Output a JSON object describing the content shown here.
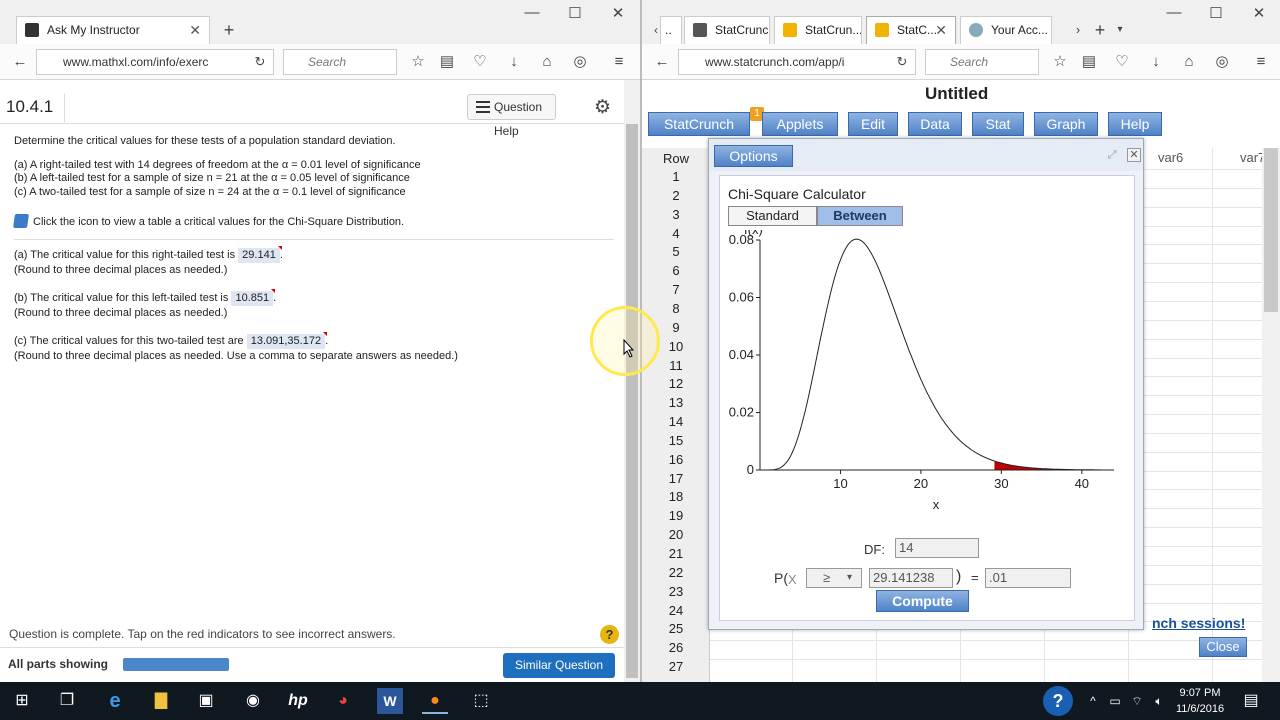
{
  "left_browser": {
    "tab_title": "Ask My Instructor",
    "url": "www.mathxl.com/info/exerc",
    "search_placeholder": "Search"
  },
  "question": {
    "number": "10.4.1",
    "help_label": "Question Help",
    "intro": "Determine the critical values for these tests of a population standard deviation.",
    "parts": [
      "(a) A right-tailed test with 14 degrees of freedom at the α = 0.01 level of significance",
      "(b) A left-tailed test for a sample of size n = 21 at the α = 0.05 level of significance",
      "(c) A two-tailed test for a sample of size n = 24 at the α = 0.1 level of significance"
    ],
    "icon_text": "Click the icon to view a table a critical values for the Chi-Square Distribution.",
    "answers": [
      {
        "prefix": "(a) The critical value for this right-tailed test is",
        "value": "29.141",
        "note": "(Round to three decimal places as needed.)"
      },
      {
        "prefix": "(b) The critical value for this left-tailed test is",
        "value": "10.851",
        "note": "(Round to three decimal places as needed.)"
      },
      {
        "prefix": "(c) The critical values for this two-tailed test are",
        "value": "13.091,35.172",
        "note": "(Round to three decimal places as needed. Use a comma to separate answers as needed.)"
      }
    ],
    "complete_msg": "Question is complete. Tap on the red indicators to see incorrect answers.",
    "all_parts": "All parts showing",
    "similar_label": "Similar Question"
  },
  "right_browser": {
    "tabs": [
      "StatCrunch",
      "StatCrun...",
      "StatC...",
      "Your Acc..."
    ],
    "url": "www.statcrunch.com/app/i",
    "search_placeholder": "Search"
  },
  "statcrunch": {
    "title": "Untitled",
    "menu": [
      "StatCrunch",
      "Applets",
      "Edit",
      "Data",
      "Stat",
      "Graph",
      "Help"
    ],
    "badge": "1",
    "row_label": "Row",
    "rows": [
      "1",
      "2",
      "3",
      "4",
      "5",
      "6",
      "7",
      "8",
      "9",
      "10",
      "11",
      "12",
      "13",
      "14",
      "15",
      "16",
      "17",
      "18",
      "19",
      "20",
      "21",
      "22",
      "23",
      "24",
      "25",
      "26",
      "27"
    ],
    "col_labels": [
      "var6",
      "var7"
    ],
    "sessions_text": "nch sessions!",
    "close_label": "Close"
  },
  "calculator": {
    "options_label": "Options",
    "title": "Chi-Square Calculator",
    "mode_standard": "Standard",
    "mode_between": "Between",
    "df_label": "DF:",
    "df_value": "14",
    "p_label": "P(",
    "x_label": "X",
    "comparator": "≥",
    "x_value": "29.141238",
    "equals": "=",
    "p_value": ".01",
    "compute_label": "Compute"
  },
  "chart_data": {
    "type": "area",
    "ylabel": "f(x)",
    "xlabel": "x",
    "xticks": [
      10,
      20,
      30,
      40
    ],
    "yticks": [
      "0",
      "0.02",
      "0.04",
      "0.06",
      "0.08"
    ],
    "xlim": [
      0,
      44
    ],
    "ylim": [
      0,
      0.08
    ],
    "distribution": "chi-square",
    "df": 14,
    "shaded_from": 29.141238,
    "shade_color": "#c00000"
  },
  "taskbar": {
    "time": "9:07 PM",
    "date": "11/6/2016"
  }
}
